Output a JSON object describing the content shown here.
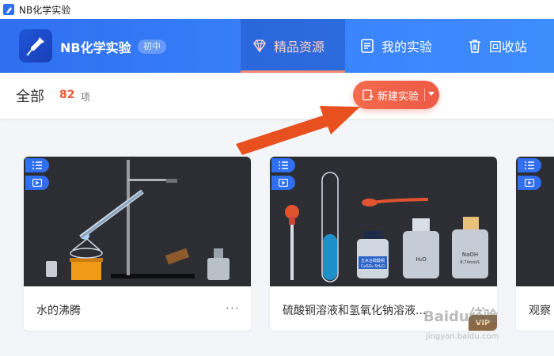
{
  "window": {
    "title": "NB化学实验"
  },
  "header": {
    "brand": "NB化学实验",
    "level_badge": "初中",
    "tabs": [
      {
        "label": "精品资源",
        "icon": "diamond-icon",
        "active": true
      },
      {
        "label": "我的实验",
        "icon": "document-icon",
        "active": false
      },
      {
        "label": "回收站",
        "icon": "trash-icon",
        "active": false
      }
    ]
  },
  "filter": {
    "title": "全部",
    "count": "82",
    "count_unit": "项",
    "new_button_label": "新建实验"
  },
  "cards": [
    {
      "title": "水的沸腾",
      "more": "···",
      "vip": ""
    },
    {
      "title": "硫酸铜溶液和氢氧化钠溶液...",
      "more": "···",
      "vip": "VIP"
    },
    {
      "title": "观察",
      "more": "",
      "vip": ""
    }
  ],
  "thumb_labels": {
    "bottle_h2o": "H₂O",
    "bottle_cuso4": "CuSO₄·5H₂O",
    "bottle_naoh": "NaOH",
    "bottle_naoh_conc": "6.74mol/L",
    "bottle_cuso4_name": "五水合硫酸铜"
  },
  "watermark": {
    "text": "Baidu经验",
    "url": "jingyan.baidu.com"
  },
  "colors": {
    "nav_blue": "#2f6ff0",
    "accent_orange": "#ee5a46",
    "annotation_arrow": "#e8501f"
  }
}
